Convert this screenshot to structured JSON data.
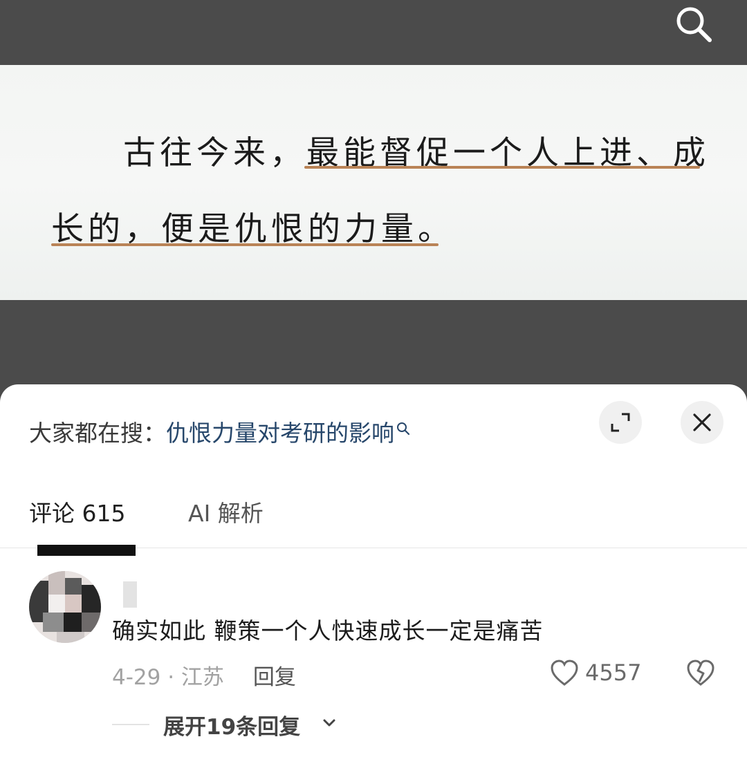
{
  "article": {
    "line1": "古往今来，最能督促一个人上进、成",
    "line2": "长的，便是仇恨的力量。"
  },
  "search_hint": {
    "prefix": "大家都在搜：",
    "query": "仇恨力量对考研的影响"
  },
  "tabs": [
    {
      "label": "评论 615",
      "active": true
    },
    {
      "label": "AI 解析",
      "active": false
    }
  ],
  "comment": {
    "text": "确实如此  鞭策一个人快速成长一定是痛苦",
    "date_location": "4-29 · 江苏",
    "reply_label": "回复",
    "like_count": "4557",
    "expand_replies": "展开19条回复"
  },
  "icons": {
    "search": "search-icon",
    "expand": "expand-icon",
    "close": "close-icon",
    "like": "heart-icon",
    "dislike": "broken-heart-icon",
    "chevron": "chevron-down-icon"
  },
  "colors": {
    "underline": "#b98356",
    "query_link": "#27476b",
    "dark_bg": "#4b4b4b"
  }
}
